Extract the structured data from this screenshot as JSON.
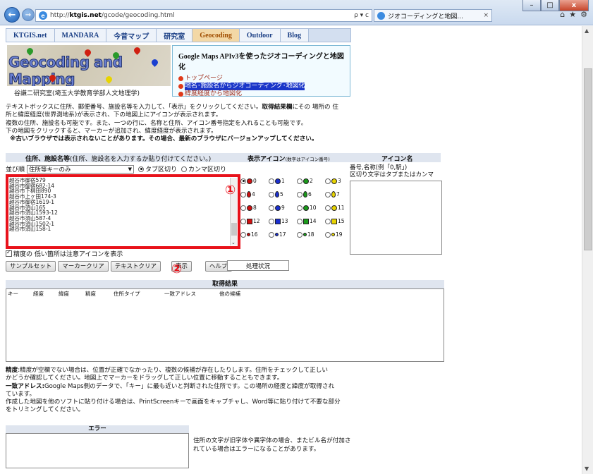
{
  "browser": {
    "url_prefix": "http://",
    "url_host": "ktgis.net",
    "url_path": "/gcode/geocoding.html",
    "addr_tools": "ρ ▾ c",
    "tab_title": "ジオコーディングと地図...",
    "minimize": "–",
    "maximize": "□",
    "close": "x"
  },
  "nav": {
    "tabs": [
      "KTGIS.net",
      "MANDARA",
      "今昔マップ",
      "研究室",
      "Geocoding",
      "Outdoor",
      "Blog"
    ],
    "active": "Geocoding"
  },
  "logo": {
    "title": "Geocoding and Mapping",
    "author": "谷謙二研究室(埼玉大学教育学部人文地理学)"
  },
  "info": {
    "title": "Google Maps APIv3を使ったジオコーディングと地図化",
    "links": [
      "トップページ",
      "地名･施設名からジオコーディング･地図化",
      "緯度経度から地図化"
    ]
  },
  "desc": {
    "line1": "テキストボックスに住所、郵便番号、施設名等を入力して、「表示」をクリックしてください。",
    "line1b": "取得結果欄",
    "line1c": "にその 場所の 住",
    "line2": "所と緯度経度(世界測地系)が表示され、下の地図上にアイコンが表示されます。",
    "line3": "複数の住所、施設名も可能です。また、一つの行に、名称と住所、アイコン番号指定を入れることも可能です。",
    "line4": "下の地図をクリックすると、マーカーが追加され、緯度経度が表示されます。",
    "line5": "※古いブラウザでは表示されないことがあります。その場合、最新のブラウザにバージョンアップしてください。"
  },
  "input_section": {
    "header_bold": "住所、施設名等",
    "header_note": "(住所、施設名を入力するか貼り付けてください。)",
    "icon_header": "表示アイコン",
    "icon_header_note": "(数字はアイコン番号)",
    "iconname_header": "アイコン名",
    "sort_label": "並び順",
    "sort_value": "住所等キーのみ",
    "tab_sep": "タブ区切り",
    "comma_sep": "カンマ区切り",
    "addresses": [
      "越谷市御宿579",
      "越谷市御宿682-14",
      "越谷市下柳田890",
      "越谷市上ヶ田174-3",
      "越谷市御宿1619-1",
      "越谷市須山165",
      "越谷市須山1593-12",
      "越谷市須山587-4",
      "越谷市須山1502-1",
      "越谷市須山158-1"
    ],
    "marker1": "①",
    "low_accuracy": "精度の 低い箇所は注意アイコンを表示",
    "iconname_desc": "番号,名称(例「0,駅」)\n区切り文字はタブまたはカンマ"
  },
  "buttons": {
    "sample": "サンプルセット",
    "marker_clear": "マーカークリア",
    "text_clear": "テキストクリア",
    "show": "表示",
    "help": "ヘルプ",
    "status": "処理状況",
    "marker2": "②"
  },
  "icons": [
    {
      "n": "0",
      "shape": "circle",
      "color": "#d01010",
      "checked": true
    },
    {
      "n": "1",
      "shape": "circle",
      "color": "#1a2fd0",
      "checked": false
    },
    {
      "n": "2",
      "shape": "circle",
      "color": "#1a9a1a",
      "checked": false
    },
    {
      "n": "3",
      "shape": "circle",
      "color": "#e8d400",
      "checked": false
    },
    {
      "n": "4",
      "shape": "pin",
      "color": "#d01010",
      "checked": false
    },
    {
      "n": "5",
      "shape": "pin",
      "color": "#1a2fd0",
      "checked": false
    },
    {
      "n": "6",
      "shape": "pin",
      "color": "#1a9a1a",
      "checked": false
    },
    {
      "n": "7",
      "shape": "pin",
      "color": "#e8d400",
      "checked": false
    },
    {
      "n": "8",
      "shape": "circle",
      "color": "#d01010",
      "checked": false
    },
    {
      "n": "9",
      "shape": "circle",
      "color": "#1a2fd0",
      "checked": false
    },
    {
      "n": "10",
      "shape": "circle",
      "color": "#1a9a1a",
      "checked": false
    },
    {
      "n": "11",
      "shape": "circle",
      "color": "#e8d400",
      "checked": false
    },
    {
      "n": "12",
      "shape": "sq",
      "color": "#d01010",
      "checked": false
    },
    {
      "n": "13",
      "shape": "sq",
      "color": "#1a2fd0",
      "checked": false
    },
    {
      "n": "14",
      "shape": "sq",
      "color": "#1a9a1a",
      "checked": false
    },
    {
      "n": "15",
      "shape": "sq",
      "color": "#e8d400",
      "checked": false
    },
    {
      "n": "16",
      "shape": "dot",
      "color": "#d01010",
      "checked": false
    },
    {
      "n": "17",
      "shape": "dot",
      "color": "#1a2fd0",
      "checked": false
    },
    {
      "n": "18",
      "shape": "dot",
      "color": "#1a9a1a",
      "checked": false
    },
    {
      "n": "19",
      "shape": "dot",
      "color": "#e8d400",
      "checked": false
    }
  ],
  "results": {
    "header": "取得結果",
    "columns": [
      "キー",
      "経度",
      "緯度",
      "精度",
      "住所タイプ",
      "一致アドレス",
      "他の候補"
    ]
  },
  "notes": {
    "p1_bold": "精度",
    "p1": ":精度が空欄でない場合は、位置が正確でなかったり、複数の候補が存在したりします。住所をチェックして正しい",
    "p1b": "かどうか確認してください。地図上でマーカーをドラッグして正しい位置に移動することもできます。",
    "p2_bold": "一致アドレス:",
    "p2": "Google Maps側のデータで、「キー」に最も近いと判断された住所です。この場所の経度と緯度が取得され",
    "p2b": "ています。",
    "p3": "作成した地図を他のソフトに貼り付ける場合は、PrintScreenキーで画面をキャプチャし、Word等に貼り付けて不要な部分",
    "p3b": "をトリミングしてください。"
  },
  "error": {
    "header": "エラー",
    "note": "住所の文字が旧字体や異字体の場合、またビル名が付加されている場合はエラーになることがあります。"
  }
}
